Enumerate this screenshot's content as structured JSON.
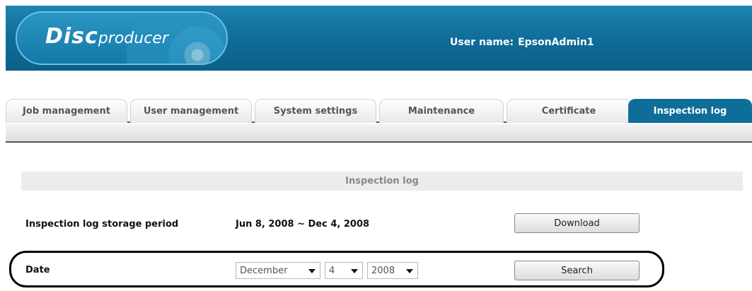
{
  "header": {
    "logo_disc": "Disc",
    "logo_producer": "producer",
    "user_label": "User name:",
    "user_name": "EpsonAdmin1"
  },
  "tabs": [
    {
      "label": "Job management"
    },
    {
      "label": "User management"
    },
    {
      "label": "System settings"
    },
    {
      "label": "Maintenance"
    },
    {
      "label": "Certificate"
    },
    {
      "label": "Inspection log",
      "active": true
    }
  ],
  "panel": {
    "title": "Inspection log",
    "storage": {
      "label": "Inspection log storage period",
      "value": "Jun 8, 2008 ~ Dec 4, 2008",
      "button": "Download"
    },
    "date": {
      "label": "Date",
      "month": "December",
      "day": "4",
      "year": "2008",
      "button": "Search"
    }
  },
  "colors": {
    "header_blue": "#0f6e99",
    "active_tab": "#0f6e99"
  }
}
